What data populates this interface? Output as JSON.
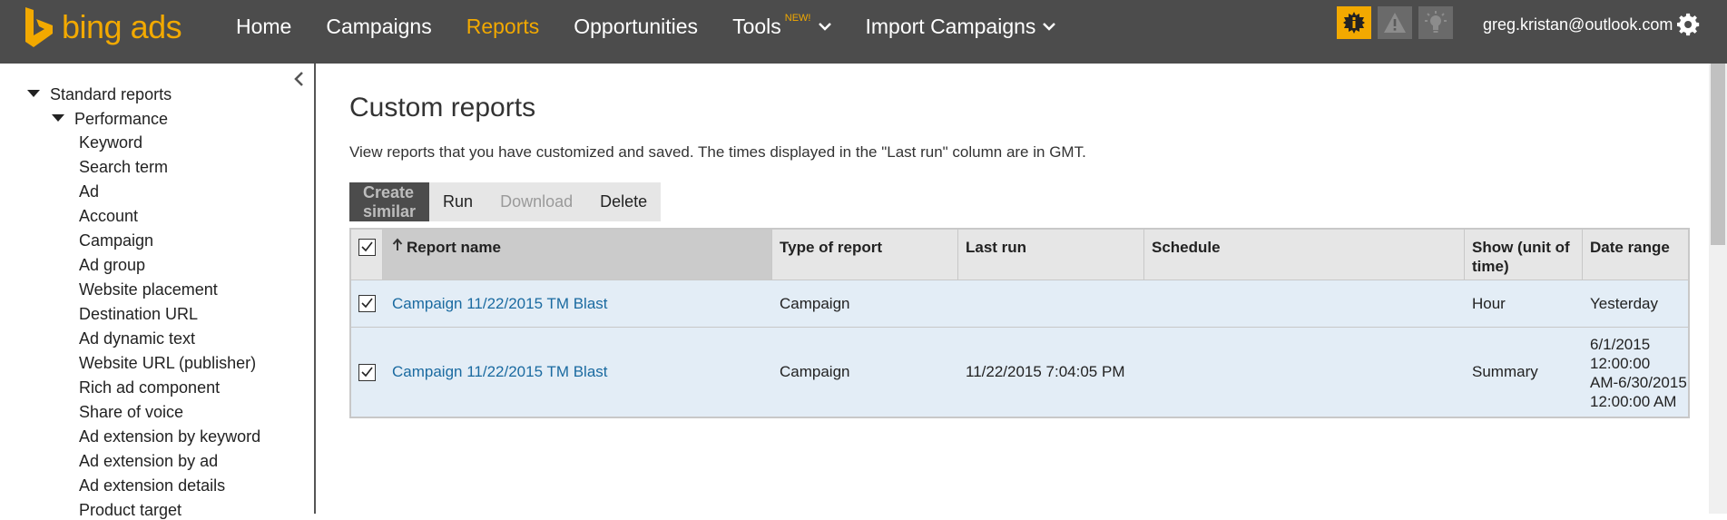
{
  "brand": {
    "name": "bing ads",
    "accent": "#f2a900",
    "topbar": "#4c4c4c"
  },
  "nav": {
    "home": "Home",
    "campaigns": "Campaigns",
    "reports": "Reports",
    "opportunities": "Opportunities",
    "tools": "Tools",
    "tools_badge": "NEW!",
    "import": "Import Campaigns"
  },
  "header": {
    "user_email": "greg.kristan@outlook.com"
  },
  "sidebar": {
    "standard_reports": "Standard reports",
    "performance": "Performance",
    "items": [
      "Keyword",
      "Search term",
      "Ad",
      "Account",
      "Campaign",
      "Ad group",
      "Website placement",
      "Destination URL",
      "Ad dynamic text",
      "Website URL (publisher)",
      "Rich ad component",
      "Share of voice",
      "Ad extension by keyword",
      "Ad extension by ad",
      "Ad extension details",
      "Product target"
    ]
  },
  "main": {
    "title": "Custom reports",
    "description": "View reports that you have customized and saved. The times displayed in the \"Last run\" column are in GMT.",
    "toolbar": {
      "create_similar": "Create similar",
      "run": "Run",
      "download": "Download",
      "delete": "Delete"
    },
    "table": {
      "headers": {
        "report_name": "Report name",
        "type": "Type of report",
        "last_run": "Last run",
        "schedule": "Schedule",
        "show_line1": "Show (unit of",
        "show_line2": "time)",
        "date_range": "Date range"
      },
      "rows": [
        {
          "checked": true,
          "name": "Campaign 11/22/2015 TM Blast",
          "type": "Campaign",
          "last_run": "",
          "schedule": "",
          "show": "Hour",
          "date_range": [
            "Yesterday"
          ]
        },
        {
          "checked": true,
          "name": "Campaign 11/22/2015 TM Blast",
          "type": "Campaign",
          "last_run": "11/22/2015 7:04:05 PM",
          "schedule": "",
          "show": "Summary",
          "date_range": [
            "6/1/2015",
            "12:00:00",
            "AM-6/30/2015",
            "12:00:00 AM"
          ]
        }
      ]
    }
  }
}
